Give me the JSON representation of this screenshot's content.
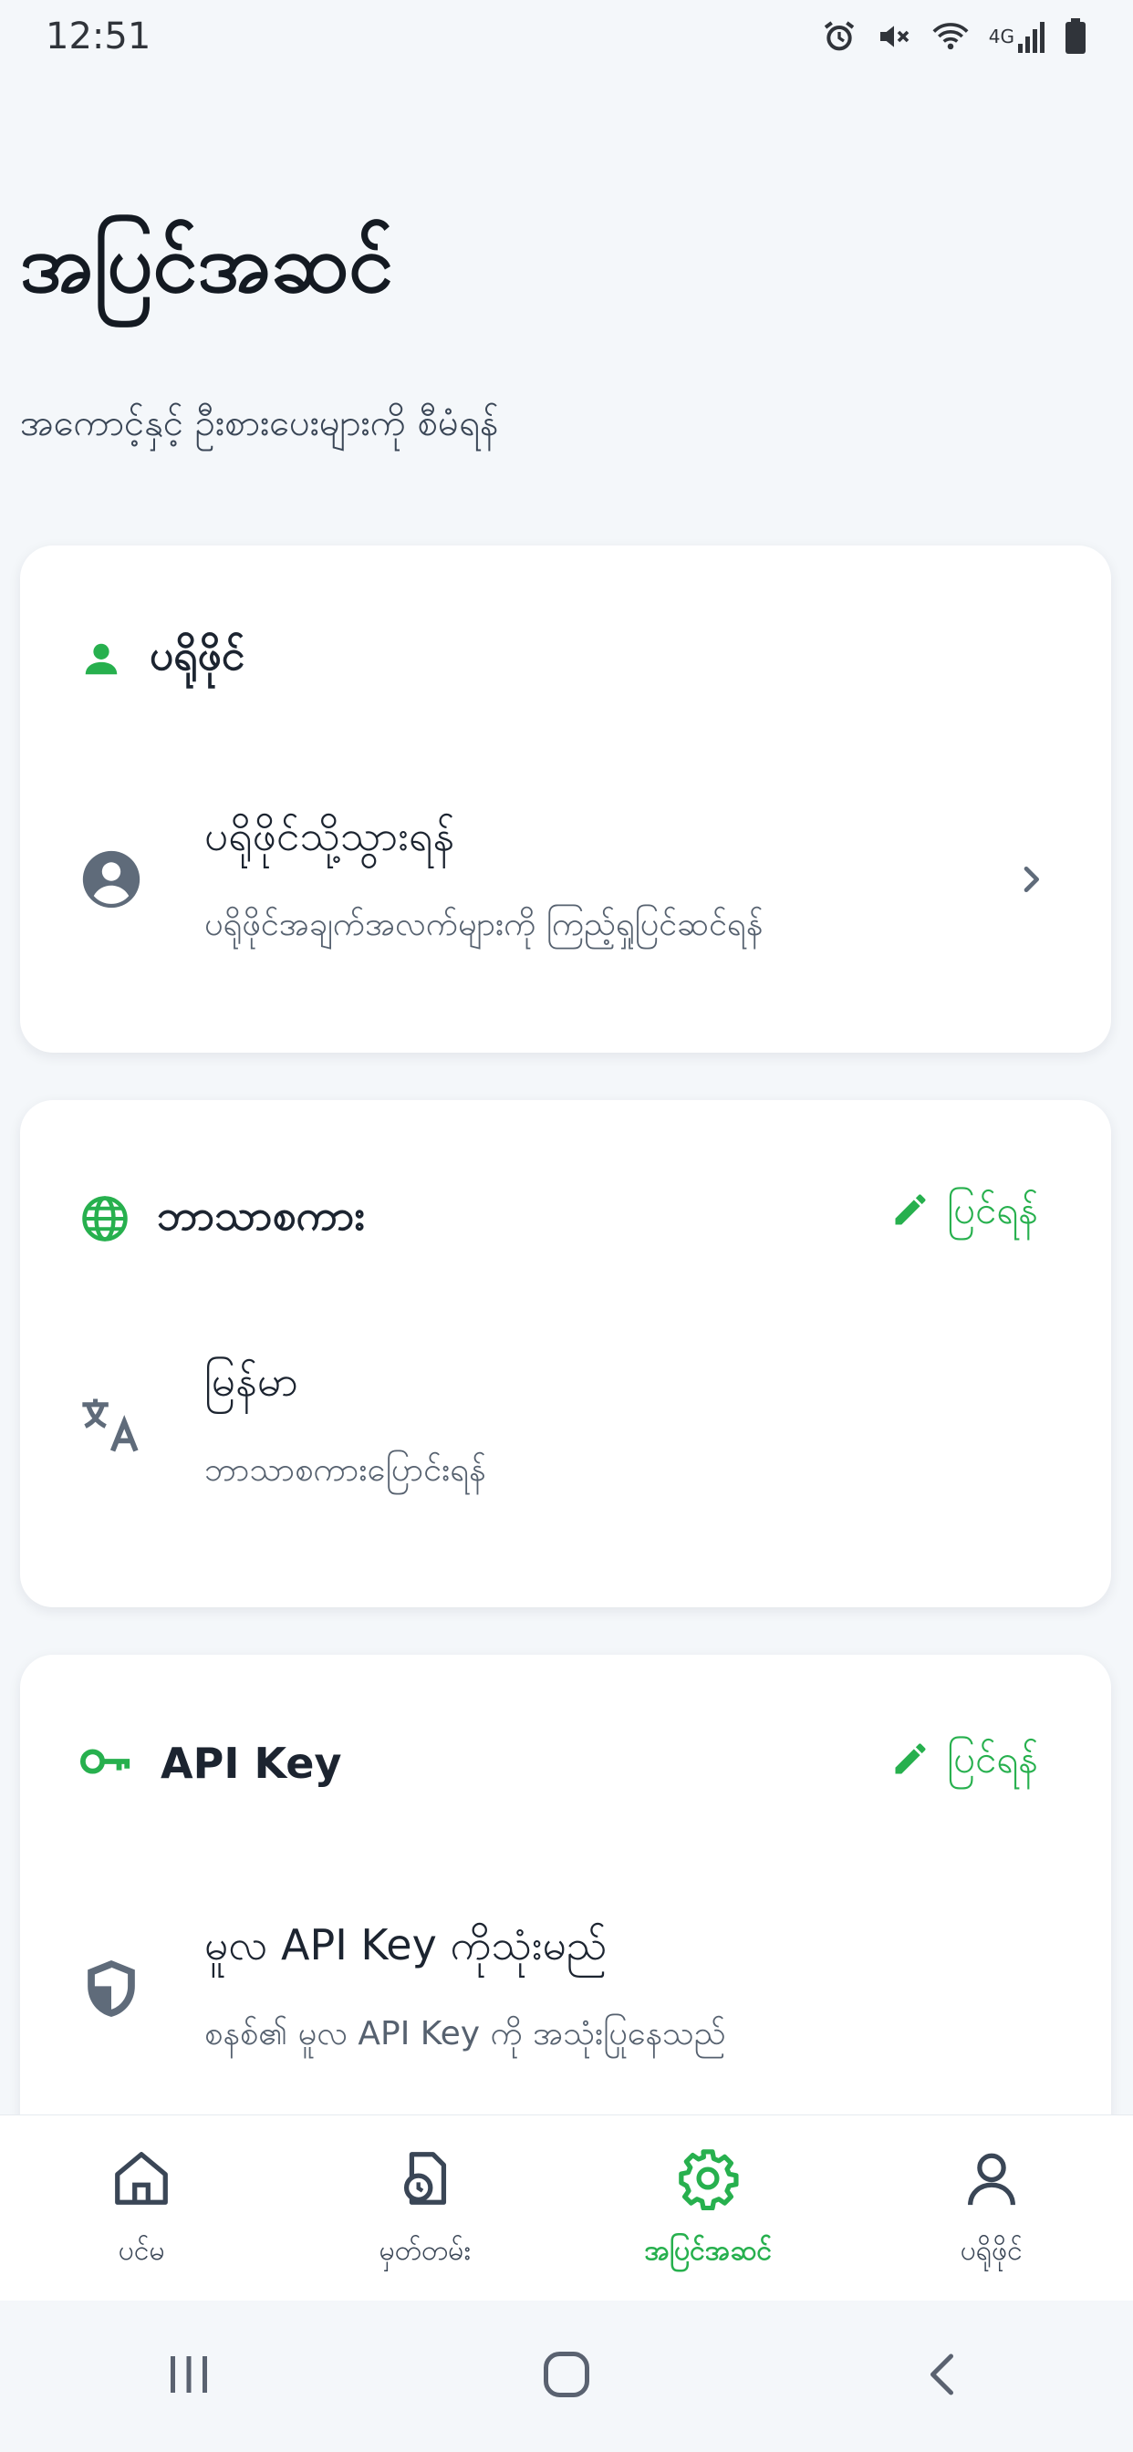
{
  "status_bar": {
    "time": "12:51",
    "network": "4G"
  },
  "header": {
    "title": "အပြင်အဆင်",
    "subtitle": "အကောင့်နှင့် ဦးစားပေးများကို စီမံရန်"
  },
  "profile_card": {
    "title": "ပရိုဖိုင်",
    "item": {
      "title": "ပရိုဖိုင်သို့သွားရန်",
      "subtitle": "ပရိုဖိုင်အချက်အလက်များကို ကြည့်ရှုပြင်ဆင်ရန်"
    }
  },
  "language_card": {
    "title": "ဘာသာစကား",
    "edit_label": "ပြင်ရန်",
    "item": {
      "title": "မြန်မာ",
      "subtitle": "ဘာသာစကားပြောင်းရန်"
    }
  },
  "api_card": {
    "title": "API Key",
    "edit_label": "ပြင်ရန်",
    "item": {
      "title": "မူလ API Key ကိုသုံးမည်",
      "subtitle": "စနစ်၏ မူလ API Key ကို အသုံးပြုနေသည်"
    }
  },
  "bottom_nav": {
    "items": [
      {
        "label": "ပင်မ",
        "icon": "home-icon"
      },
      {
        "label": "မှတ်တမ်း",
        "icon": "history-icon"
      },
      {
        "label": "အပြင်အဆင်",
        "icon": "gear-icon"
      },
      {
        "label": "ပရိုဖိုင်",
        "icon": "person-icon"
      }
    ],
    "active_index": 2
  },
  "colors": {
    "accent": "#27b04e",
    "background": "#f4f7fa",
    "card": "#ffffff",
    "text": "#1c2430"
  }
}
